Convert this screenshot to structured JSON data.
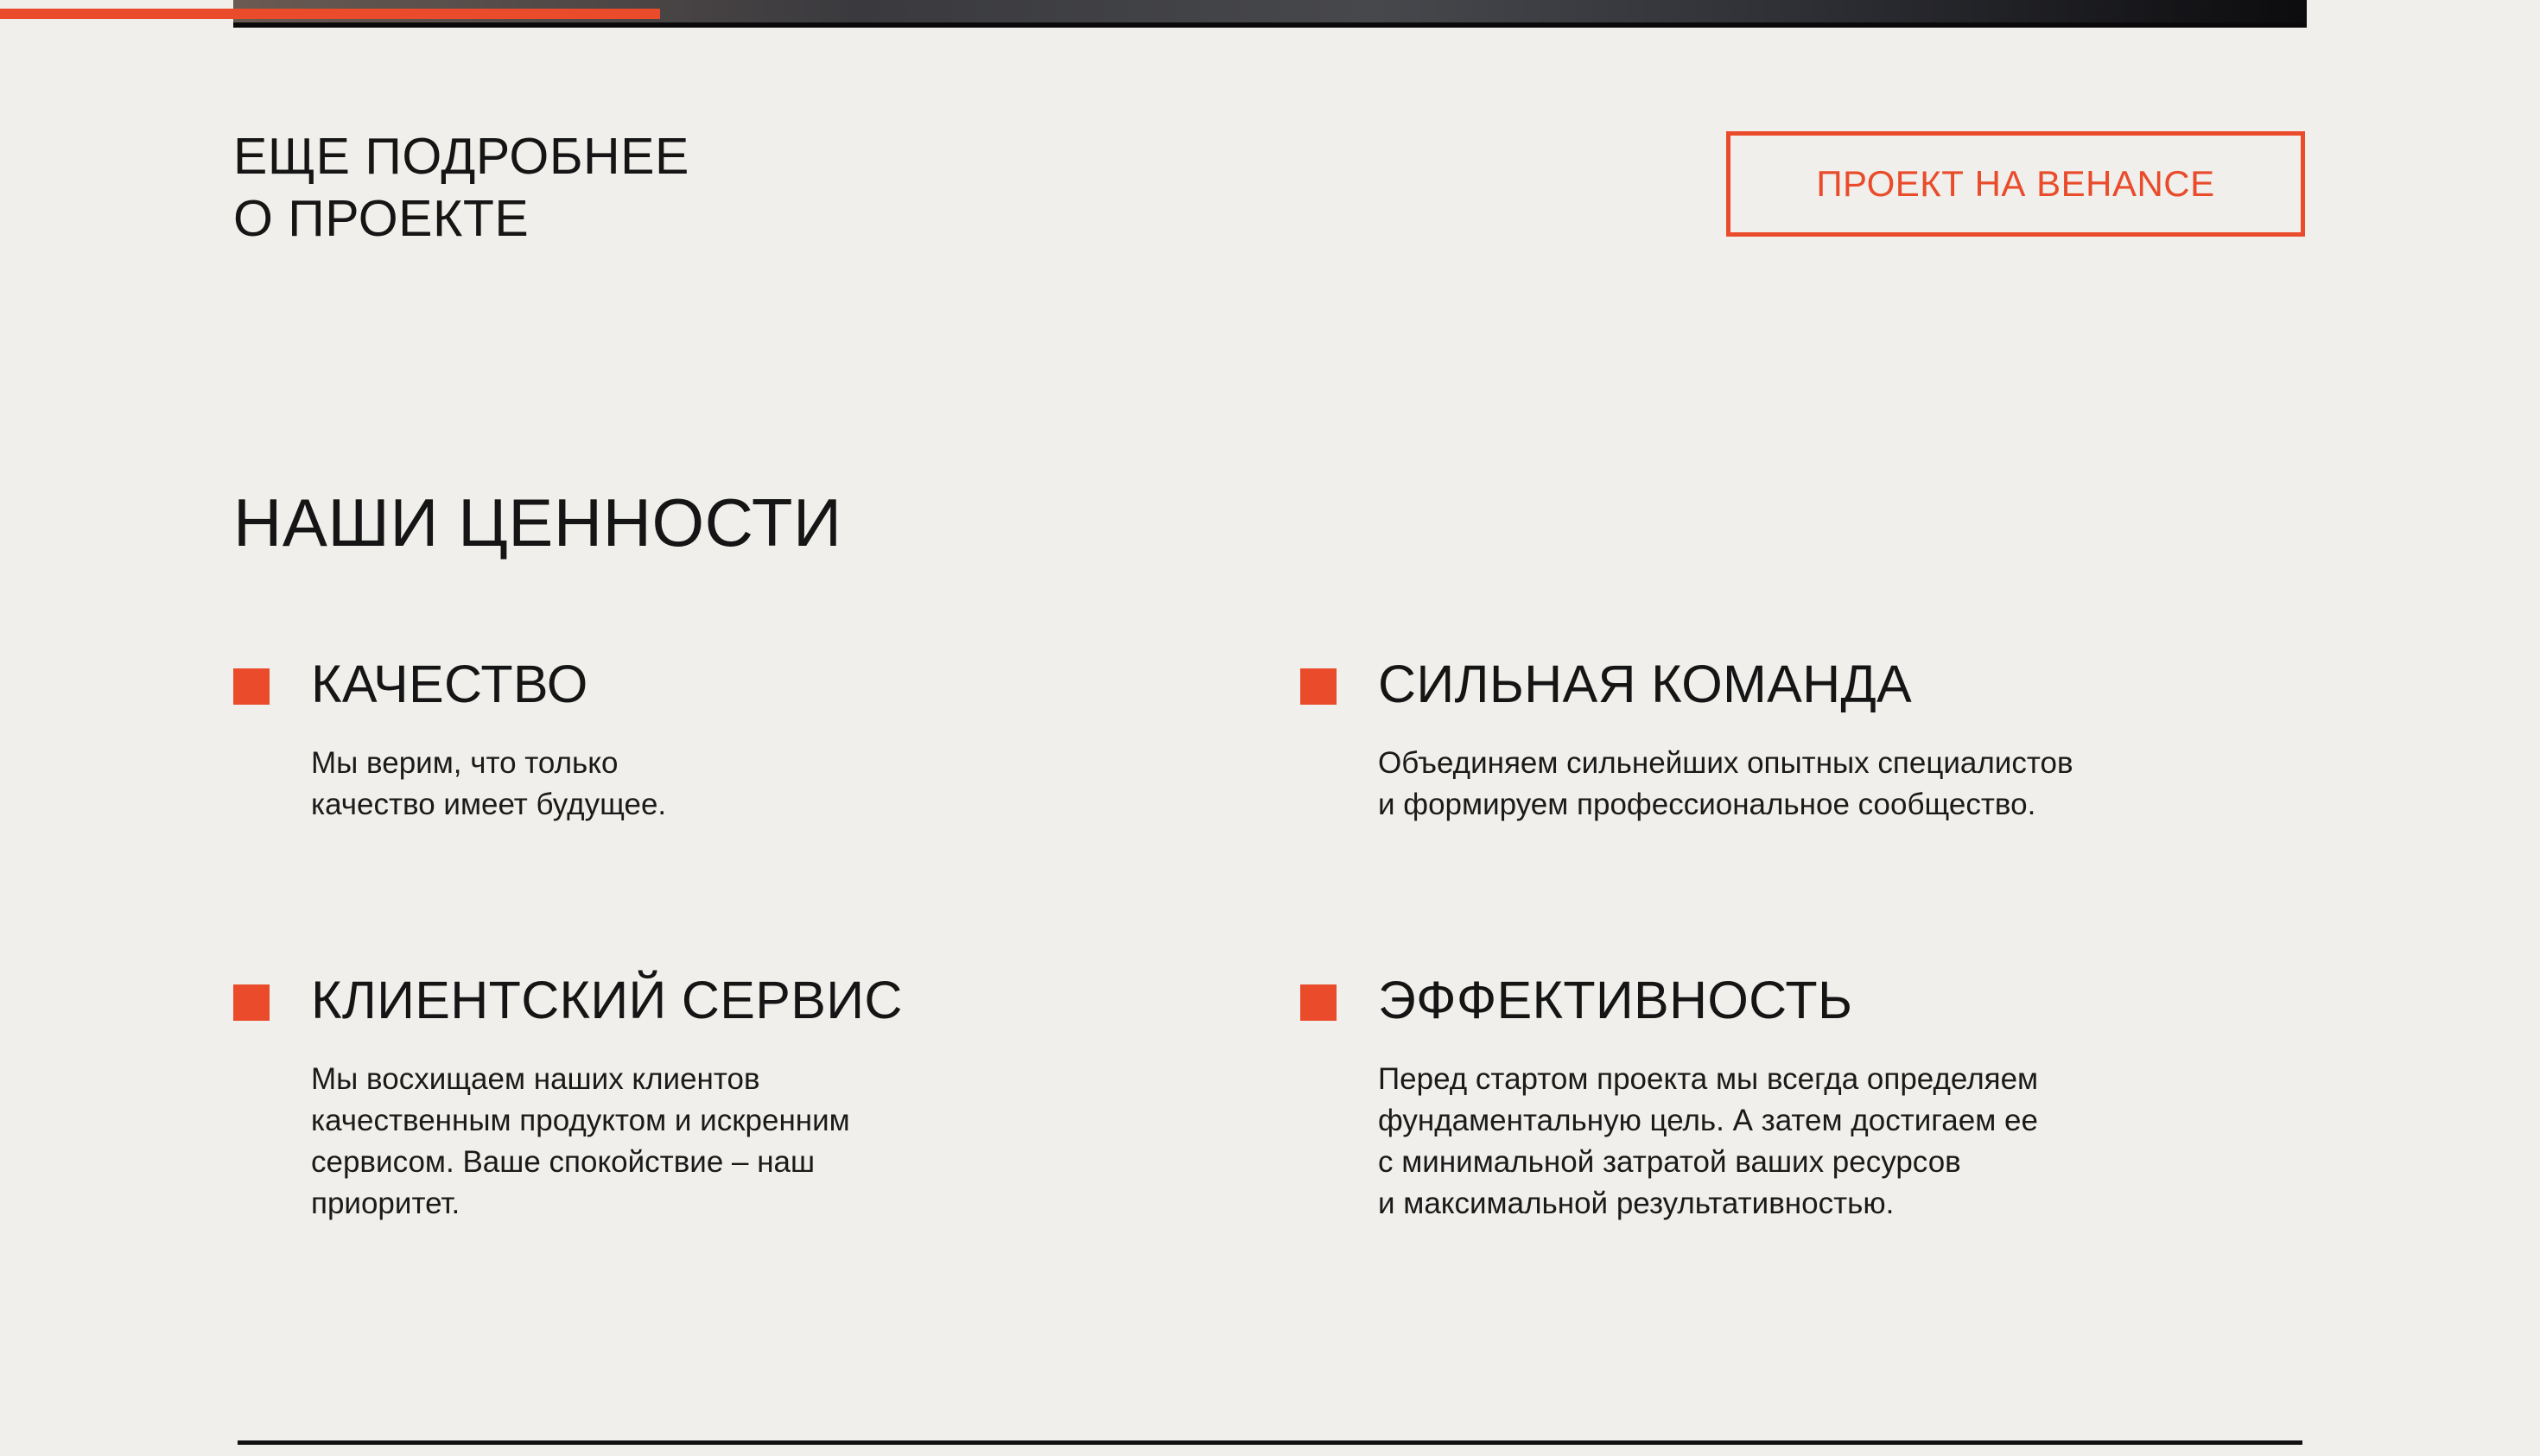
{
  "progress": {
    "fraction": 0.26,
    "color": "#e94b2b"
  },
  "more": {
    "title_lines": [
      "ЕЩЕ ПОДРОБНЕЕ",
      "О ПРОЕКТЕ"
    ],
    "button_label": "ПРОЕКТ НА BEHANCE"
  },
  "values": {
    "title": "НАШИ ЦЕННОСТИ",
    "items": [
      {
        "title": "КАЧЕСТВО",
        "lines": [
          "Мы верим, что только",
          "качество имеет будущее."
        ]
      },
      {
        "title": "СИЛЬНАЯ КОМАНДА",
        "lines": [
          "Объединяем сильнейших опытных специалистов",
          "и формируем профессиональное сообщество."
        ]
      },
      {
        "title": "КЛИЕНТСКИЙ СЕРВИС",
        "lines": [
          "Мы восхищаем наших клиентов",
          "качественным продуктом и искренним",
          "сервисом. Ваше спокойствие – наш",
          "приоритет."
        ]
      },
      {
        "title": "ЭФФЕКТИВНОСТЬ",
        "lines": [
          "Перед стартом проекта мы всегда определяем",
          "фундаментальную цель. А затем достигаем ее",
          "с минимальной затратой ваших ресурсов",
          "и максимальной результативностью."
        ]
      }
    ]
  },
  "colors": {
    "accent": "#e94b2b",
    "background": "#f0efeb",
    "text": "#151515"
  },
  "icons": {
    "value_marker": "square-marker-icon"
  }
}
